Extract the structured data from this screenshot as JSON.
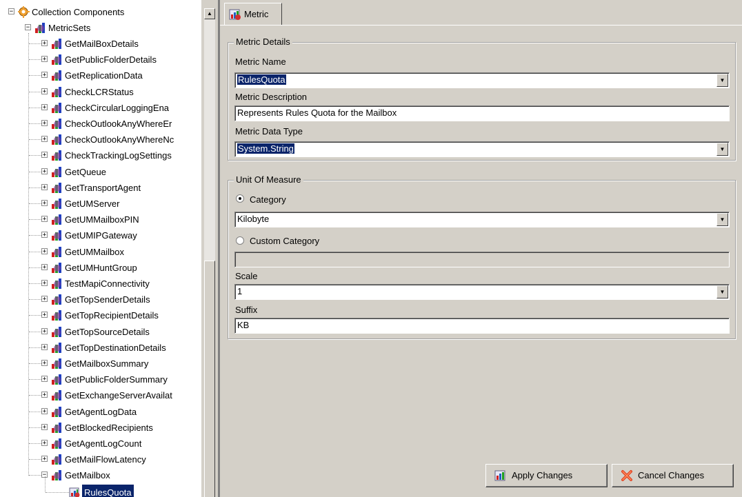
{
  "tree": {
    "root_label": "Collection Components",
    "metricsets_label": "MetricSets",
    "items": [
      "GetMailBoxDetails",
      "GetPublicFolderDetails",
      "GetReplicationData",
      "CheckLCRStatus",
      "CheckCircularLoggingEna",
      "CheckOutlookAnyWhereEr",
      "CheckOutlookAnyWhereNc",
      "CheckTrackingLogSettings",
      "GetQueue",
      "GetTransportAgent",
      "GetUMServer",
      "GetUMMailboxPIN",
      "GetUMIPGateway",
      "GetUMMailbox",
      "GetUMHuntGroup",
      "TestMapiConnectivity",
      "GetTopSenderDetails",
      "GetTopRecipientDetails",
      "GetTopSourceDetails",
      "GetTopDestinationDetails",
      "GetMailboxSummary",
      "GetPublicFolderSummary",
      "GetExchangeServerAvailat",
      "GetAgentLogData",
      "GetBlockedRecipients",
      "GetAgentLogCount",
      "GetMailFlowLatency",
      "GetMailbox"
    ],
    "selected_leaf": "RulesQuota"
  },
  "tab": {
    "label": "Metric"
  },
  "metric_details": {
    "legend": "Metric Details",
    "name_label": "Metric Name",
    "name_value": "RulesQuota",
    "description_label": "Metric Description",
    "description_value": "Represents Rules Quota for the Mailbox",
    "datatype_label": "Metric Data Type",
    "datatype_value": "System.String"
  },
  "unit_of_measure": {
    "legend": "Unit Of Measure",
    "category_label": "Category",
    "category_selected": true,
    "category_value": "Kilobyte",
    "custom_category_label": "Custom Category",
    "custom_category_value": "",
    "scale_label": "Scale",
    "scale_value": "1",
    "suffix_label": "Suffix",
    "suffix_value": "KB"
  },
  "buttons": {
    "apply_label": "Apply Changes",
    "cancel_label": "Cancel Changes"
  },
  "colors": {
    "selection": "#0a246a",
    "panel": "#d4d0c8"
  }
}
